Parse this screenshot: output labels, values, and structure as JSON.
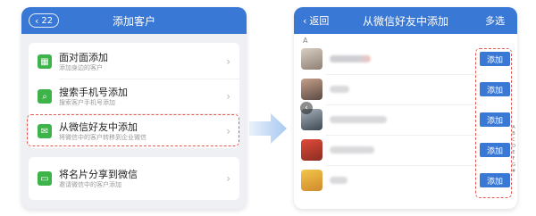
{
  "left_screen": {
    "badge": "22",
    "title": "添加客户",
    "items": [
      {
        "title": "面对面添加",
        "subtitle": "添加身边的客户"
      },
      {
        "title": "搜索手机号添加",
        "subtitle": "搜索客户手机号添加"
      },
      {
        "title": "从微信好友中添加",
        "subtitle": "将微信中的客户转移到企业微信"
      },
      {
        "title": "将名片分享到微信",
        "subtitle": "邀请微信中的客户添加"
      }
    ]
  },
  "right_screen": {
    "back_label": "返回",
    "title": "从微信好友中添加",
    "multi_select": "多选",
    "section_letter": "A",
    "add_label": "添加",
    "alphabet": [
      "A",
      "B",
      "C",
      "D",
      "E",
      "F",
      "G",
      "#"
    ]
  },
  "colors": {
    "accent_blue": "#3a78d6",
    "icon_green": "#3db34a",
    "highlight_red": "#e25a52"
  }
}
